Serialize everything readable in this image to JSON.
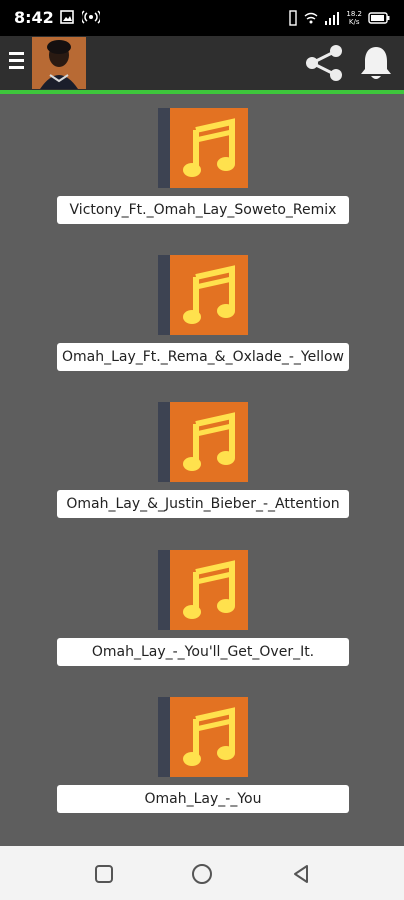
{
  "status_bar": {
    "time": "8:42",
    "speed_value": "18.2",
    "speed_unit": "K/s",
    "left_icons": [
      "gallery-icon",
      "hotspot-icon"
    ],
    "right_icons": [
      "vibrate-icon",
      "wifi-icon",
      "signal-icon",
      "battery-icon"
    ]
  },
  "app_bar": {
    "menu_icon": "hamburger-menu-icon",
    "avatar_alt": "artist-avatar",
    "share_icon": "share-icon",
    "notification_icon": "bell-icon",
    "accent_color": "#3ec63c"
  },
  "songs": [
    {
      "title": "Victony_Ft._Omah_Lay_Soweto_Remix"
    },
    {
      "title": "Omah_Lay_Ft._Rema_&_Oxlade_-_Yellow"
    },
    {
      "title": "Omah_Lay_&_Justin_Bieber_-_Attention"
    },
    {
      "title": "Omah_Lay_-_You'll_Get_Over_It."
    },
    {
      "title": "Omah_Lay_-_You"
    }
  ],
  "thumb_colors": {
    "cover": "#e37222",
    "spine": "#3d4352",
    "note": "#ffe14d"
  },
  "nav_bar": {
    "recent_icon": "recent-apps-icon",
    "home_icon": "home-icon",
    "back_icon": "back-icon"
  }
}
